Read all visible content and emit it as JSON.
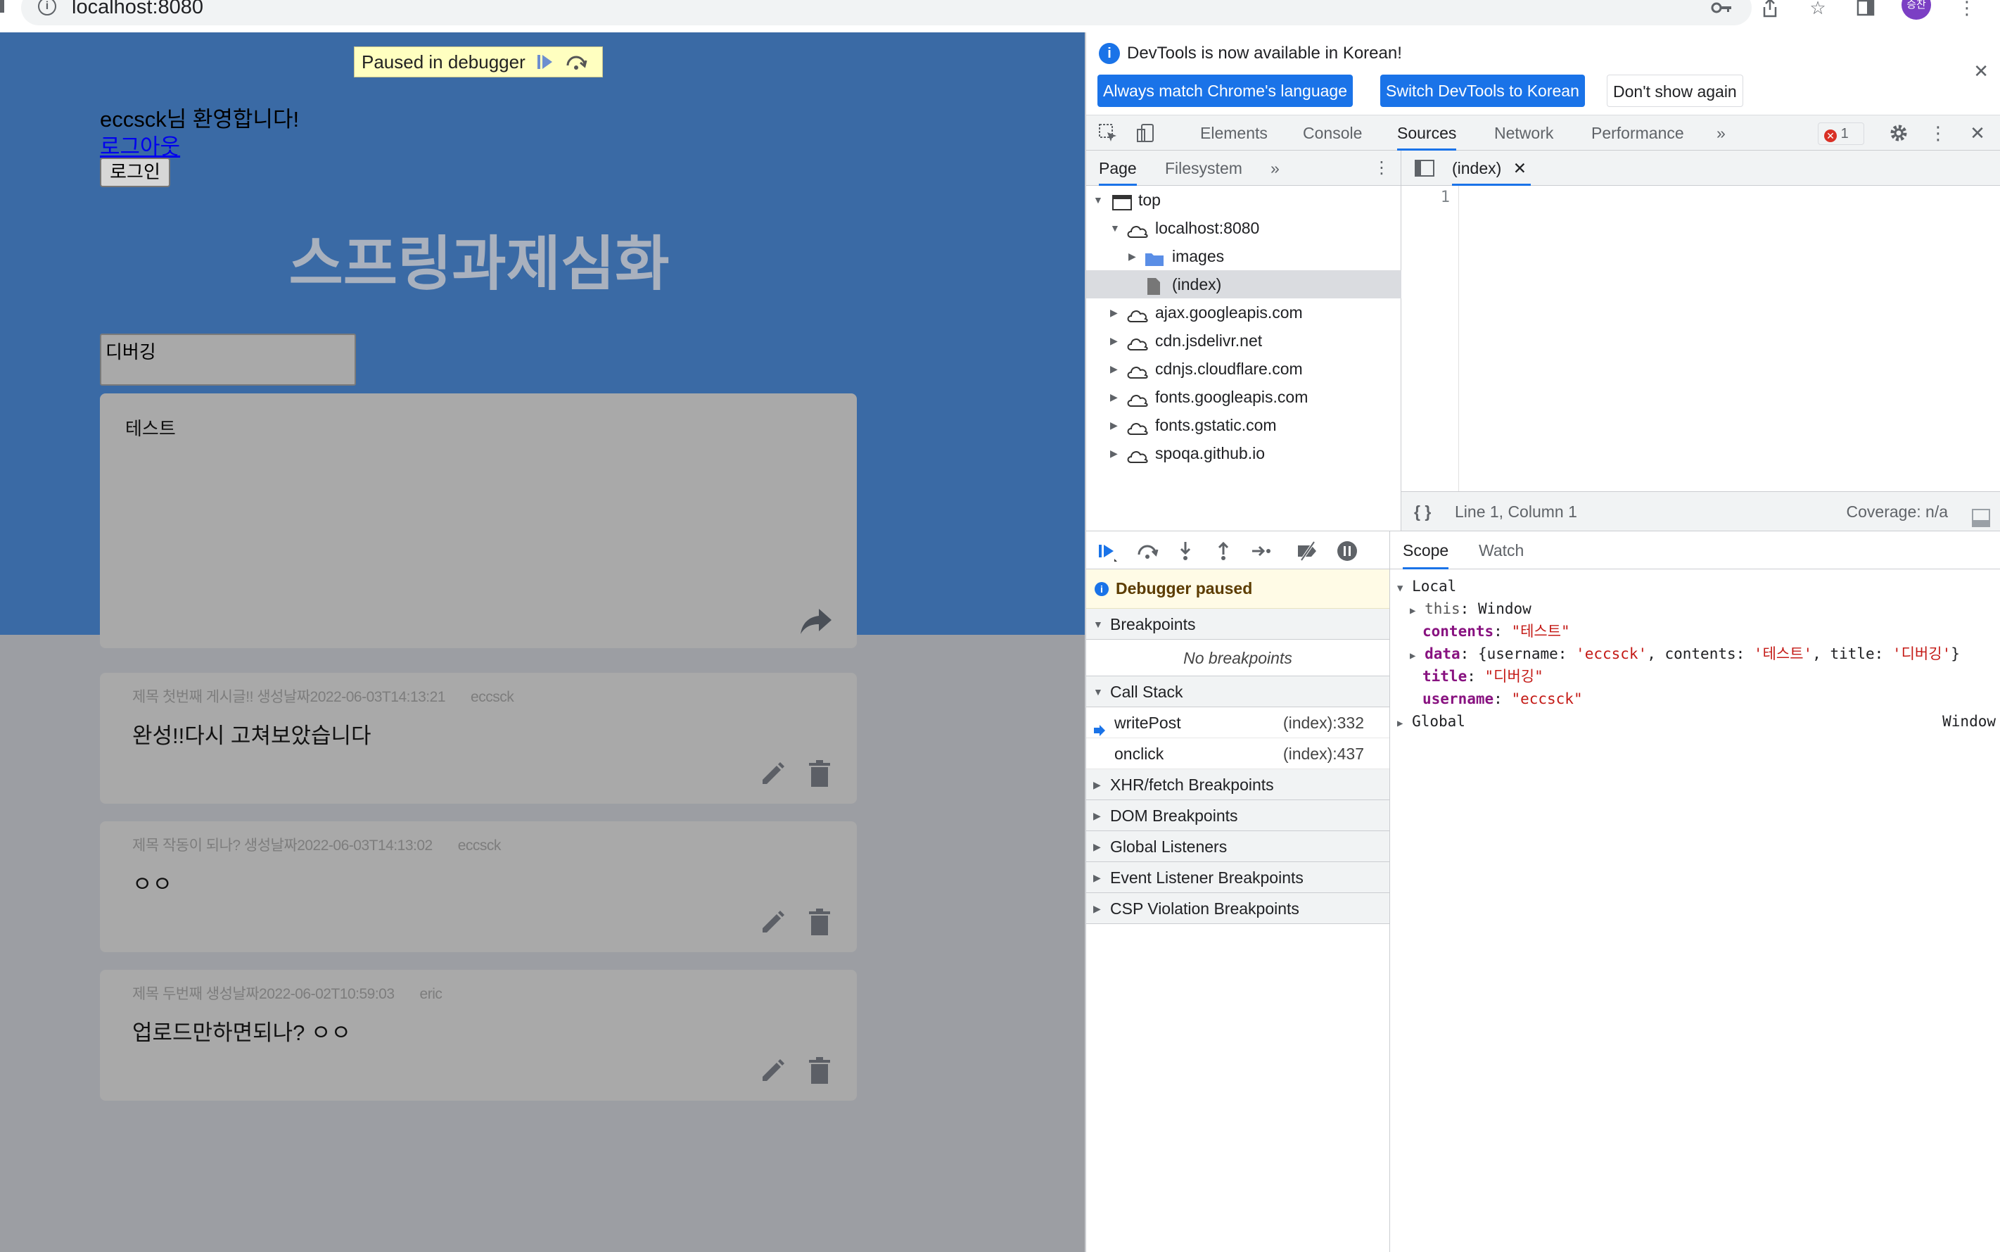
{
  "browser": {
    "url": "localhost:8080",
    "avatar_text": "승찬"
  },
  "page": {
    "paused_badge": "Paused in debugger",
    "welcome": "eccsck님 환영합니다!",
    "logout": "로그아웃",
    "login": "로그인",
    "site_title": "스프링과제심화",
    "title_input_value": "디버깅",
    "contents_value": "테스트",
    "posts": [
      {
        "meta": "제목 첫번째 게시글!! 생성날짜2022-06-03T14:13:21",
        "author": "eccsck",
        "body": "완성!!다시 고쳐보았습니다"
      },
      {
        "meta": "제목 작동이 되나? 생성날짜2022-06-03T14:13:02",
        "author": "eccsck",
        "body": "ㅇㅇ"
      },
      {
        "meta": "제목 두번째 생성날짜2022-06-02T10:59:03",
        "author": "eric",
        "body": "업로드만하면되나? ㅇㅇ"
      }
    ],
    "colors": {
      "hero": "#3a6aa5",
      "background": "#9c9ea3",
      "card": "#a9a9a9"
    }
  },
  "devtools": {
    "infobar": {
      "message": "DevTools is now available in Korean!",
      "btn_match": "Always match Chrome's language",
      "btn_switch": "Switch DevTools to Korean",
      "btn_dont": "Don't show again"
    },
    "tabs": [
      "Elements",
      "Console",
      "Sources",
      "Network",
      "Performance"
    ],
    "active_tab": "Sources",
    "error_count": "1",
    "navigator": {
      "tabs": [
        "Page",
        "Filesystem"
      ],
      "tree": [
        {
          "label": "top",
          "icon": "frame-icon"
        },
        {
          "label": "localhost:8080",
          "icon": "cloud-icon"
        },
        {
          "label": "images",
          "icon": "folder-icon"
        },
        {
          "label": "(index)",
          "icon": "file-icon"
        },
        {
          "label": "ajax.googleapis.com",
          "icon": "cloud-icon"
        },
        {
          "label": "cdn.jsdelivr.net",
          "icon": "cloud-icon"
        },
        {
          "label": "cdnjs.cloudflare.com",
          "icon": "cloud-icon"
        },
        {
          "label": "fonts.googleapis.com",
          "icon": "cloud-icon"
        },
        {
          "label": "fonts.gstatic.com",
          "icon": "cloud-icon"
        },
        {
          "label": "spoqa.github.io",
          "icon": "cloud-icon"
        }
      ]
    },
    "editor": {
      "tab": "(index)",
      "line_number": "1",
      "status_position": "Line 1, Column 1",
      "coverage": "Coverage: n/a"
    },
    "debugger": {
      "paused": "Debugger paused",
      "breakpoints": "Breakpoints",
      "no_breakpoints": "No breakpoints",
      "call_stack": "Call Stack",
      "frames": [
        {
          "name": "writePost",
          "location": "(index):332"
        },
        {
          "name": "onclick",
          "location": "(index):437"
        }
      ],
      "sections": [
        "XHR/fetch Breakpoints",
        "DOM Breakpoints",
        "Global Listeners",
        "Event Listener Breakpoints",
        "CSP Violation Breakpoints"
      ]
    },
    "scope": {
      "tabs": [
        "Scope",
        "Watch"
      ],
      "local": "Local",
      "this_key": "this",
      "this_val": "Window",
      "contents_key": "contents",
      "contents_val": "\"테스트\"",
      "data_key": "data",
      "data_open": "{username: ",
      "data_username": "'eccsck'",
      "data_mid1": ", contents: ",
      "data_contents": "'테스트'",
      "data_mid2": ", title: ",
      "data_title": "'디버깅'",
      "data_close": "}",
      "title_key": "title",
      "title_val": "\"디버깅\"",
      "username_key": "username",
      "username_val": "\"eccsck\"",
      "global": "Global",
      "global_val": "Window"
    }
  }
}
